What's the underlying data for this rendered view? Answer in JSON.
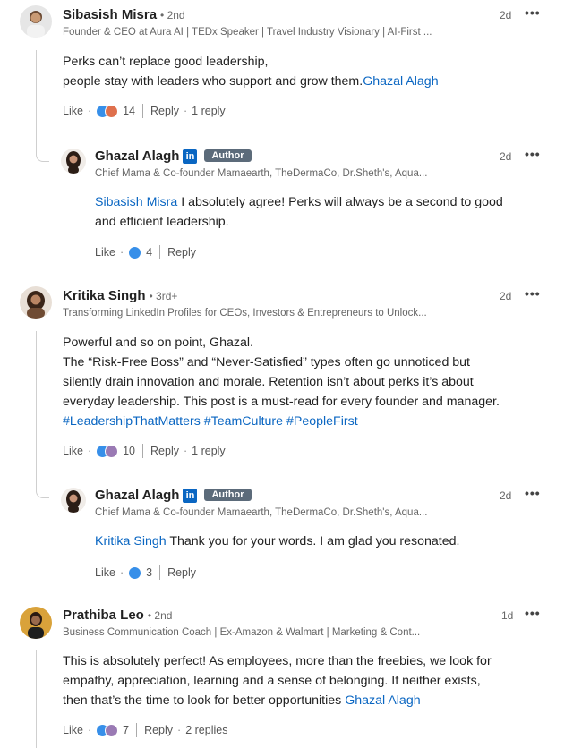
{
  "comments": [
    {
      "name": "Sibasish Misra",
      "degree": "• 2nd",
      "headline": "Founder & CEO at Aura AI | TEDx Speaker | Travel Industry Visionary | AI-First ...",
      "time": "2d",
      "body_line1": "Perks can’t replace good leadership,",
      "body_line2": " people stay with leaders who support and grow them.",
      "mention": "Ghazal Alagh",
      "like_label": "Like",
      "reaction_count": "14",
      "reply_label": "Reply",
      "reply_count": "1 reply",
      "reply": {
        "name": "Ghazal Alagh",
        "linkedin_badge": "in",
        "author_badge": "Author",
        "headline": "Chief Mama & Co-founder Mamaearth, TheDermaCo, Dr.Sheth's, Aqua...",
        "time": "2d",
        "mention": "Sibasish Misra",
        "body_line1": " I absolutely agree! Perks will always be a second to good",
        "body_line2": "and efficient leadership.",
        "like_label": "Like",
        "reaction_count": "4",
        "reply_label": "Reply"
      }
    },
    {
      "name": "Kritika Singh",
      "degree": "• 3rd+",
      "headline": "Transforming LinkedIn Profiles for CEOs, Investors & Entrepreneurs to Unlock...",
      "time": "2d",
      "body_line1": "Powerful and so on point, Ghazal.",
      "body_line2": " The “Risk-Free Boss” and “Never-Satisfied” types often go unnoticed but",
      "body_line3": "silently drain innovation and morale. Retention isn’t about perks it’s about",
      "body_line4": "everyday leadership. This post is a must-read for every founder and manager.",
      "hashtags": "#LeadershipThatMatters #TeamCulture #PeopleFirst",
      "like_label": "Like",
      "reaction_count": "10",
      "reply_label": "Reply",
      "reply_count": "1 reply",
      "reply": {
        "name": "Ghazal Alagh",
        "linkedin_badge": "in",
        "author_badge": "Author",
        "headline": "Chief Mama & Co-founder Mamaearth, TheDermaCo, Dr.Sheth's, Aqua...",
        "time": "2d",
        "mention": "Kritika Singh",
        "body_line1": " Thank you for your words. I am glad you resonated.",
        "like_label": "Like",
        "reaction_count": "3",
        "reply_label": "Reply"
      }
    },
    {
      "name": "Prathiba Leo",
      "degree": "• 2nd",
      "headline": "Business Communication Coach | Ex-Amazon & Walmart | Marketing & Cont...",
      "time": "1d",
      "body_line1": "This is absolutely perfect! As employees, more than the freebies, we look for",
      "body_line2": "empathy, appreciation, learning and a sense of belonging. If neither exists,",
      "body_line3": "then that’s the time to look for better opportunities ",
      "mention": "Ghazal Alagh",
      "like_label": "Like",
      "reaction_count": "7",
      "reply_label": "Reply",
      "reply_count": "2 replies"
    }
  ],
  "more_icon": "more-options-icon",
  "colors": {
    "link": "#0a66c2",
    "author_badge": "#5c6b7a",
    "like": "#378fe9"
  }
}
